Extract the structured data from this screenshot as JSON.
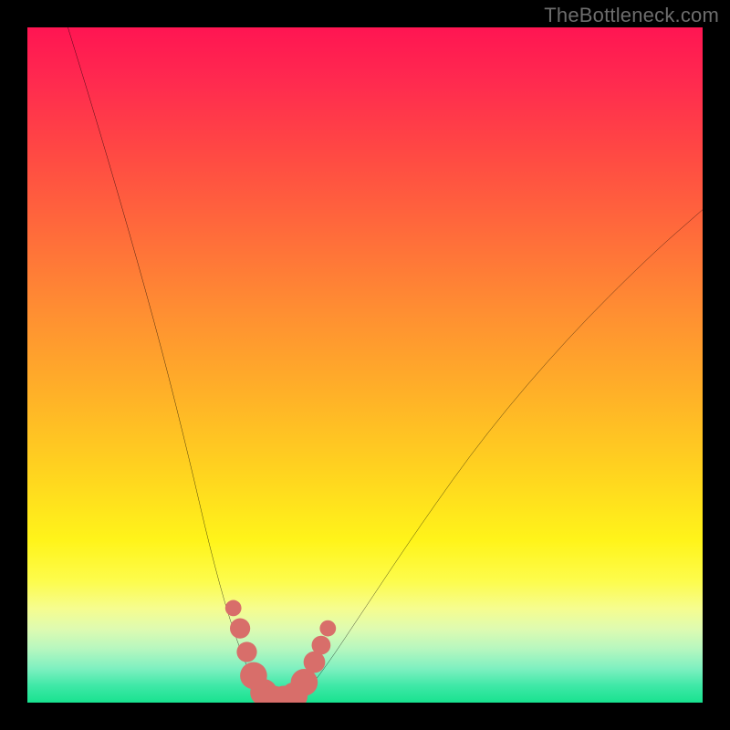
{
  "watermark": "TheBottleneck.com",
  "chart_data": {
    "type": "line",
    "title": "",
    "xlabel": "",
    "ylabel": "",
    "xlim": [
      0,
      100
    ],
    "ylim": [
      0,
      100
    ],
    "gradient_stops": [
      {
        "pos": 0,
        "color": "#ff1552"
      },
      {
        "pos": 8,
        "color": "#ff2a4f"
      },
      {
        "pos": 18,
        "color": "#ff4744"
      },
      {
        "pos": 30,
        "color": "#ff6a3b"
      },
      {
        "pos": 42,
        "color": "#ff8e32"
      },
      {
        "pos": 54,
        "color": "#ffb028"
      },
      {
        "pos": 66,
        "color": "#ffd41f"
      },
      {
        "pos": 76,
        "color": "#fff41a"
      },
      {
        "pos": 82,
        "color": "#fdfc4c"
      },
      {
        "pos": 86,
        "color": "#f6fd8e"
      },
      {
        "pos": 89,
        "color": "#dffbb0"
      },
      {
        "pos": 92,
        "color": "#b7f7bf"
      },
      {
        "pos": 95,
        "color": "#7df0c0"
      },
      {
        "pos": 97.5,
        "color": "#3fe8a7"
      },
      {
        "pos": 100,
        "color": "#18e28f"
      }
    ],
    "series": [
      {
        "name": "left-branch",
        "x": [
          6,
          10,
          15,
          20,
          24,
          27,
          30,
          33,
          35
        ],
        "y": [
          100,
          87,
          70,
          52,
          36,
          23,
          12,
          4,
          0
        ]
      },
      {
        "name": "right-branch",
        "x": [
          40,
          44,
          50,
          58,
          68,
          80,
          92,
          100
        ],
        "y": [
          0,
          5,
          14,
          26,
          40,
          54,
          66,
          73
        ]
      }
    ],
    "markers": {
      "name": "highlight-dots",
      "color": "#d86e6a",
      "points": [
        {
          "x": 30.5,
          "y": 14.0,
          "r": 1.2
        },
        {
          "x": 31.5,
          "y": 11.0,
          "r": 1.5
        },
        {
          "x": 32.5,
          "y": 7.5,
          "r": 1.5
        },
        {
          "x": 33.5,
          "y": 4.0,
          "r": 2.0
        },
        {
          "x": 35.0,
          "y": 1.5,
          "r": 2.0
        },
        {
          "x": 36.5,
          "y": 0.5,
          "r": 2.0
        },
        {
          "x": 38.0,
          "y": 0.5,
          "r": 2.0
        },
        {
          "x": 39.5,
          "y": 1.0,
          "r": 2.0
        },
        {
          "x": 41.0,
          "y": 3.0,
          "r": 2.0
        },
        {
          "x": 42.5,
          "y": 6.0,
          "r": 1.6
        },
        {
          "x": 43.5,
          "y": 8.5,
          "r": 1.4
        },
        {
          "x": 44.5,
          "y": 11.0,
          "r": 1.2
        }
      ]
    }
  }
}
